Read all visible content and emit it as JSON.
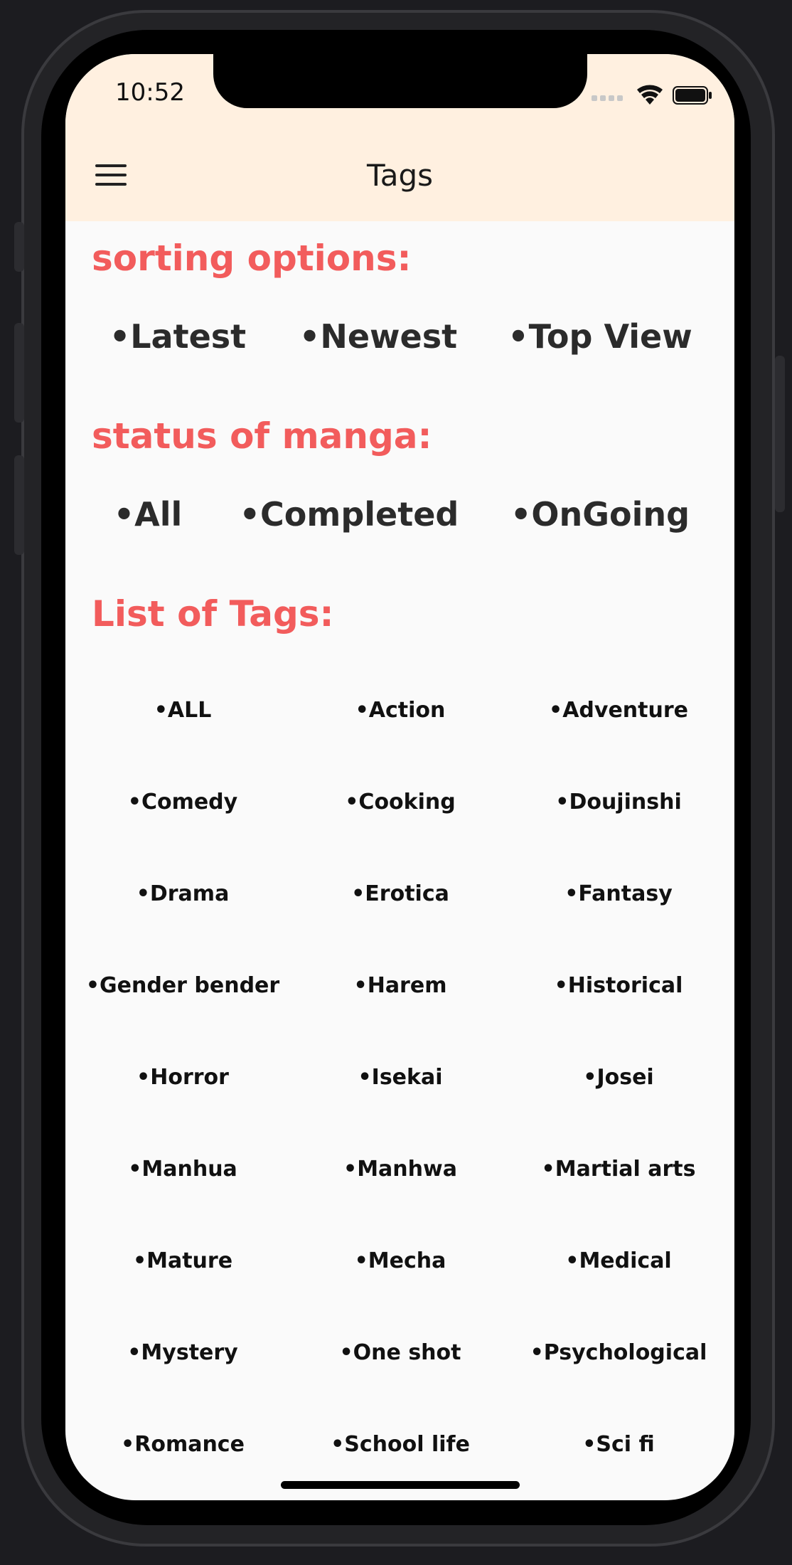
{
  "status_bar": {
    "time": "10:52"
  },
  "app_bar": {
    "title": "Tags"
  },
  "sorting": {
    "title": "sorting options:",
    "options": [
      "•Latest",
      "•Newest",
      "•Top View"
    ]
  },
  "status": {
    "title": "status of manga:",
    "options": [
      "•All",
      "•Completed",
      "•OnGoing"
    ]
  },
  "tags": {
    "title": "List of Tags:",
    "items": [
      "•ALL",
      "•Action",
      "•Adventure",
      "•Comedy",
      "•Cooking",
      "•Doujinshi",
      "•Drama",
      "•Erotica",
      "•Fantasy",
      "•Gender bender",
      "•Harem",
      "•Historical",
      "•Horror",
      "•Isekai",
      "•Josei",
      "•Manhua",
      "•Manhwa",
      "•Martial arts",
      "•Mature",
      "•Mecha",
      "•Medical",
      "•Mystery",
      "•One shot",
      "•Psychological",
      "•Romance",
      "•School life",
      "•Sci fi"
    ]
  },
  "colors": {
    "accent": "#f25c5c",
    "app_bar_bg": "#fff0e0",
    "body_bg": "#fafafa"
  }
}
